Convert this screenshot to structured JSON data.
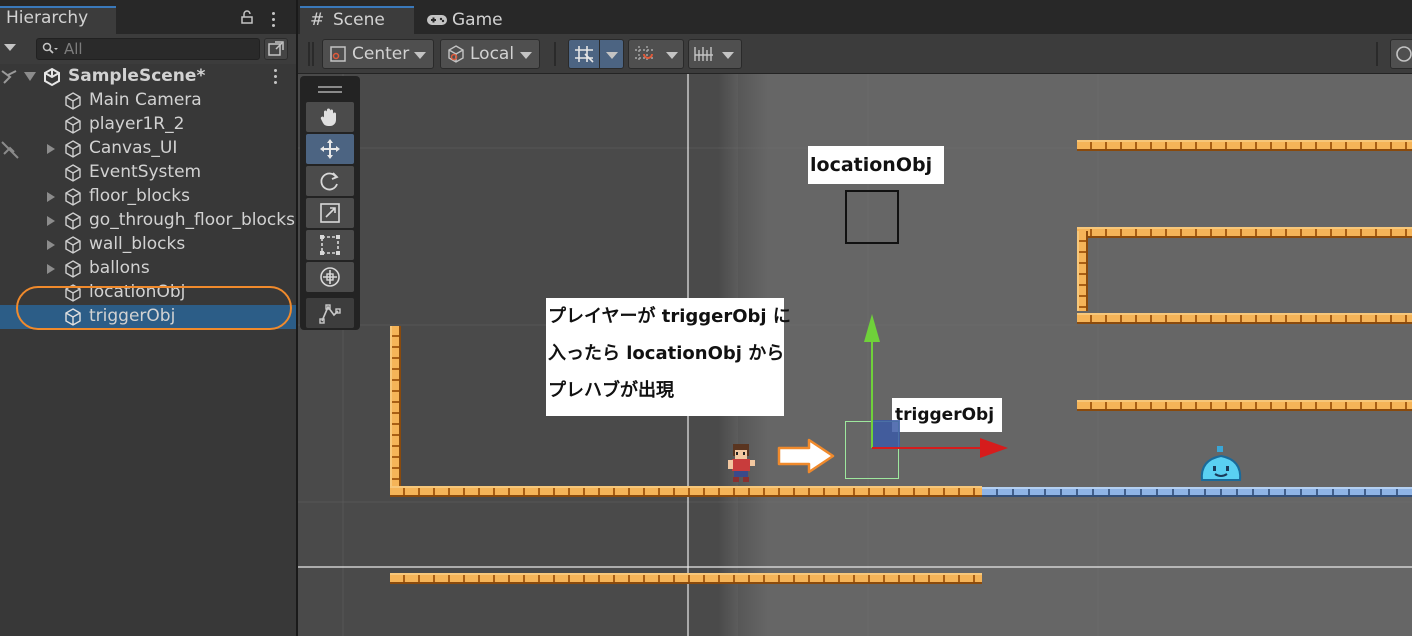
{
  "hierarchy": {
    "title": "Hierarchy",
    "search_placeholder": "All",
    "scene_name": "SampleScene*",
    "items": [
      {
        "label": "Main Camera"
      },
      {
        "label": "player1R_2"
      },
      {
        "label": "Canvas_UI"
      },
      {
        "label": "EventSystem"
      },
      {
        "label": "floor_blocks"
      },
      {
        "label": "go_through_floor_blocks"
      },
      {
        "label": "wall_blocks"
      },
      {
        "label": "ballons"
      },
      {
        "label": "locationObj"
      },
      {
        "label": "triggerObj"
      }
    ],
    "selected_item": "triggerObj"
  },
  "scene_view": {
    "tabs": [
      {
        "label": "Scene",
        "active": true
      },
      {
        "label": "Game",
        "active": false
      }
    ],
    "pivot_mode": "Center",
    "pivot_rotation": "Local"
  },
  "annotations": {
    "location_label": "locationObj",
    "trigger_label": "triggerObj",
    "callout_lines": [
      "プレイヤーが triggerObj に",
      "入ったら locationObj から",
      "プレハブが出現"
    ]
  },
  "colors": {
    "selection": "#2c5d87",
    "accent_tab": "#3a79bb",
    "highlight_ellipse": "#f08a2c",
    "gizmo_x": "#d61c1c",
    "gizmo_y": "#6fd13a"
  }
}
